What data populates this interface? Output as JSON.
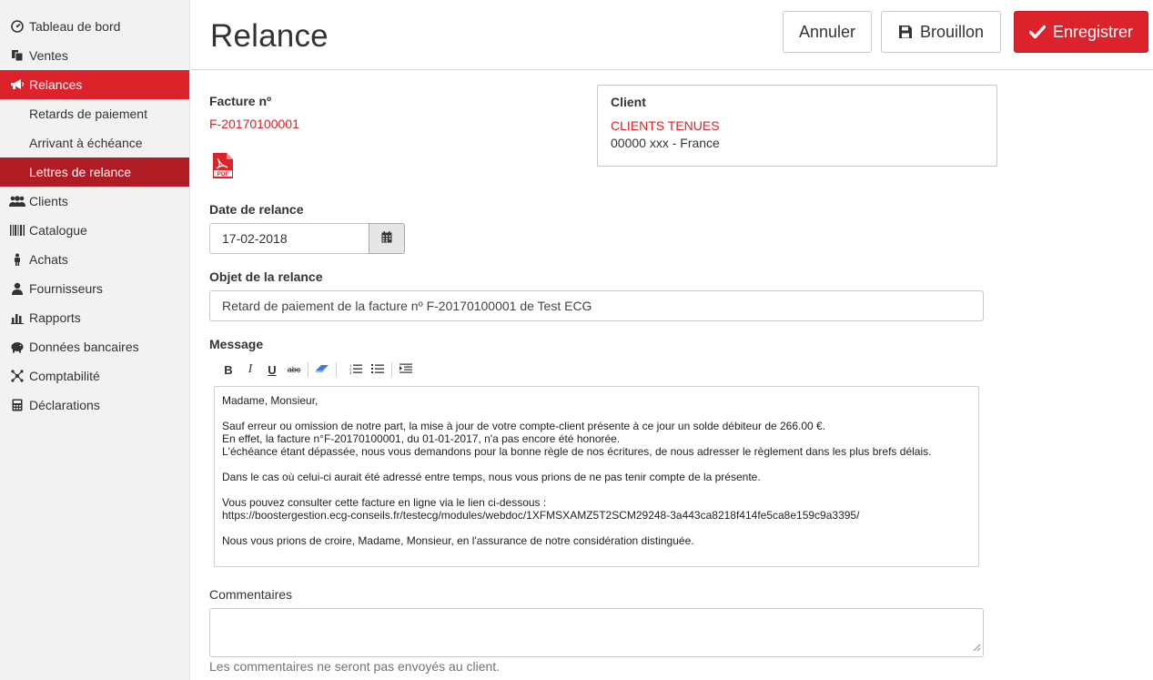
{
  "sidebar": {
    "items": [
      {
        "label": "Tableau de bord",
        "icon": "dashboard-icon"
      },
      {
        "label": "Ventes",
        "icon": "files-icon"
      },
      {
        "label": "Relances",
        "icon": "megaphone-icon"
      },
      {
        "label": "Clients",
        "icon": "users-icon"
      },
      {
        "label": "Catalogue",
        "icon": "barcode-icon"
      },
      {
        "label": "Achats",
        "icon": "buyer-icon"
      },
      {
        "label": "Fournisseurs",
        "icon": "user-icon"
      },
      {
        "label": "Rapports",
        "icon": "bar-chart-icon"
      },
      {
        "label": "Données bancaires",
        "icon": "piggy-bank-icon"
      },
      {
        "label": "Comptabilité",
        "icon": "network-icon"
      },
      {
        "label": "Déclarations",
        "icon": "calculator-icon"
      }
    ],
    "subitems": [
      {
        "label": "Retards de paiement"
      },
      {
        "label": "Arrivant à échéance"
      },
      {
        "label": "Lettres de relance"
      }
    ]
  },
  "header": {
    "title": "Relance",
    "cancel_label": "Annuler",
    "draft_label": "Brouillon",
    "save_label": "Enregistrer"
  },
  "invoice": {
    "label": "Facture nº",
    "number": "F-20170100001"
  },
  "client": {
    "label": "Client",
    "name": "CLIENTS TENUES",
    "address": "00000 xxx - France"
  },
  "date": {
    "label": "Date de relance",
    "value": "17-02-2018"
  },
  "subject": {
    "label": "Objet de la relance",
    "value": "Retard de paiement de la facture nº F-20170100001 de Test ECG"
  },
  "message": {
    "label": "Message",
    "lines": [
      "Madame, Monsieur,",
      "",
      "Sauf erreur ou omission de notre part, la mise à jour de votre compte-client présente à ce jour un solde débiteur de 266.00 €.",
      "En effet, la facture n°F-20170100001, du 01-01-2017, n'a pas encore été honorée.",
      "L'échéance étant dépassée, nous vous demandons pour la bonne règle de nos écritures, de nous adresser le règlement dans les plus brefs délais.",
      "",
      "Dans le cas où celui-ci aurait été adressé entre temps, nous vous prions de ne pas tenir compte de la présente.",
      "",
      "Vous pouvez consulter cette facture en ligne via le lien ci-dessous :",
      "https://boostergestion.ecg-conseils.fr/testecg/modules/webdoc/1XFMSXAMZ5T2SCM29248-3a443ca8218f414fe5ca8e159c9a3395/",
      "",
      "Nous vous prions de croire, Madame, Monsieur, en l'assurance de notre considération distinguée."
    ]
  },
  "comments": {
    "label": "Commentaires",
    "value": "",
    "help": "Les commentaires ne seront pas envoyés au client."
  },
  "colors": {
    "accent": "#dc222b",
    "accent_dark": "#b01c24"
  }
}
